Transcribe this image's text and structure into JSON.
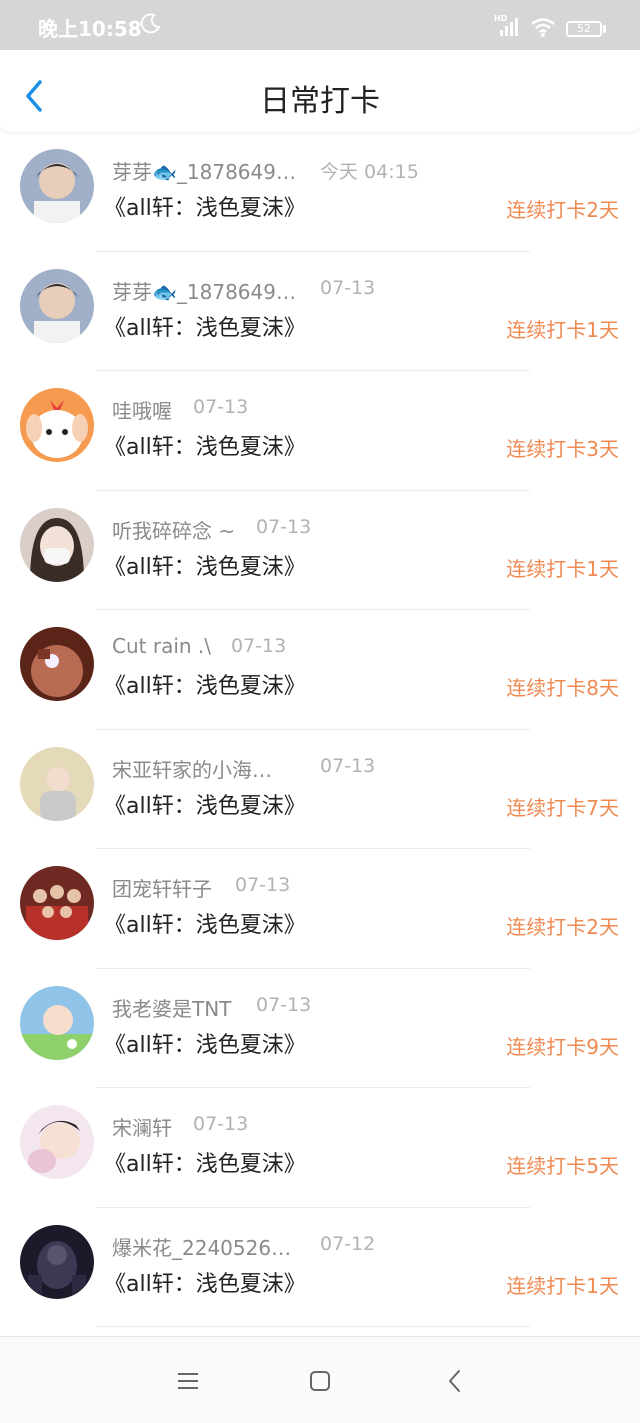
{
  "status_bar": {
    "time": "晚上10:58",
    "hd_label": "HD",
    "battery": "52",
    "icons": [
      "moon-icon",
      "signal-icon",
      "wifi-icon",
      "battery-icon"
    ]
  },
  "header": {
    "title": "日常打卡",
    "back_icon": "back-chevron-icon"
  },
  "colors": {
    "streak": "#ef8a52",
    "accent": "#1a90e8",
    "name": "#8a8a8a",
    "status_bar_bg": "#d6d6d6"
  },
  "items": [
    {
      "name": "芽芽🐟_1878649…",
      "time": "今天 04:15",
      "book": "《all轩：浅色夏沫》",
      "streak": "连续打卡2天"
    },
    {
      "name": "芽芽🐟_1878649…",
      "time": "07-13",
      "book": "《all轩：浅色夏沫》",
      "streak": "连续打卡1天"
    },
    {
      "name": "哇哦喔",
      "time": "07-13",
      "book": "《all轩：浅色夏沫》",
      "streak": "连续打卡3天"
    },
    {
      "name": "听我碎碎念 ~",
      "time": "07-13",
      "book": "《all轩：浅色夏沫》",
      "streak": "连续打卡1天"
    },
    {
      "name": "Cut rain .\\",
      "time": "07-13",
      "book": "《all轩：浅色夏沫》",
      "streak": "连续打卡8天"
    },
    {
      "name": "宋亚轩家的小海…",
      "time": "07-13",
      "book": "《all轩：浅色夏沫》",
      "streak": "连续打卡7天"
    },
    {
      "name": "团宠轩轩子",
      "time": "07-13",
      "book": "《all轩：浅色夏沫》",
      "streak": "连续打卡2天"
    },
    {
      "name": "我老婆是TNT",
      "time": "07-13",
      "book": "《all轩：浅色夏沫》",
      "streak": "连续打卡9天"
    },
    {
      "name": "宋澜轩",
      "time": "07-13",
      "book": "《all轩：浅色夏沫》",
      "streak": "连续打卡5天"
    },
    {
      "name": "爆米花_2240526…",
      "time": "07-12",
      "book": "《all轩：浅色夏沫》",
      "streak": "连续打卡1天"
    }
  ],
  "nav_bar": {
    "icons": [
      "menu-icon",
      "home-square-icon",
      "back-triangle-icon"
    ]
  }
}
